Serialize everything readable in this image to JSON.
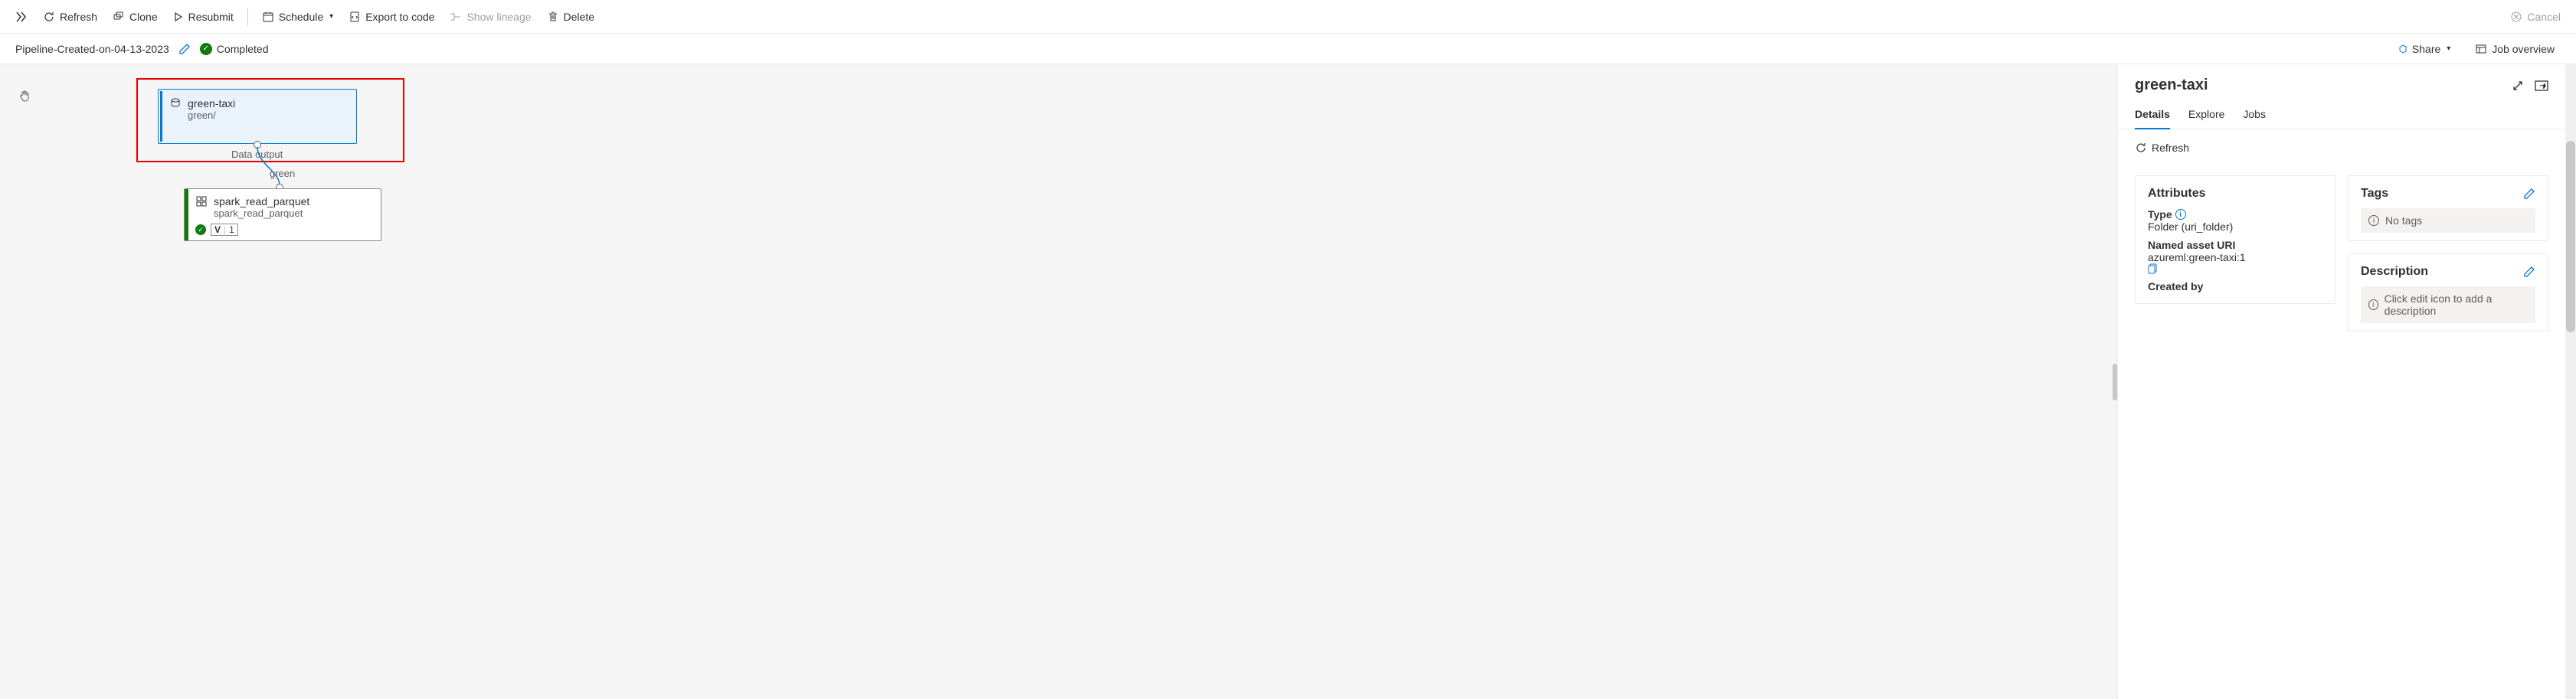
{
  "toolbar": {
    "refresh": "Refresh",
    "clone": "Clone",
    "resubmit": "Resubmit",
    "schedule": "Schedule",
    "export": "Export to code",
    "lineage": "Show lineage",
    "delete": "Delete",
    "cancel": "Cancel"
  },
  "info": {
    "pipeline_name": "Pipeline-Created-on-04-13-2023",
    "status": "Completed",
    "share": "Share",
    "overview": "Job overview"
  },
  "canvas": {
    "data_node": {
      "title": "green-taxi",
      "sub": "green/",
      "port_label": "Data output"
    },
    "edge_label": "green",
    "compute_node": {
      "title": "spark_read_parquet",
      "sub": "spark_read_parquet",
      "version_prefix": "V",
      "version": "1"
    }
  },
  "panel": {
    "title": "green-taxi",
    "tabs": {
      "details": "Details",
      "explore": "Explore",
      "jobs": "Jobs"
    },
    "refresh": "Refresh",
    "attributes": {
      "header": "Attributes",
      "type_label": "Type",
      "type_value": "Folder (uri_folder)",
      "uri_label": "Named asset URI",
      "uri_value": "azureml:green-taxi:1",
      "created_by_label": "Created by"
    },
    "tags": {
      "header": "Tags",
      "empty": "No tags"
    },
    "description": {
      "header": "Description",
      "placeholder": "Click edit icon to add a description"
    }
  }
}
